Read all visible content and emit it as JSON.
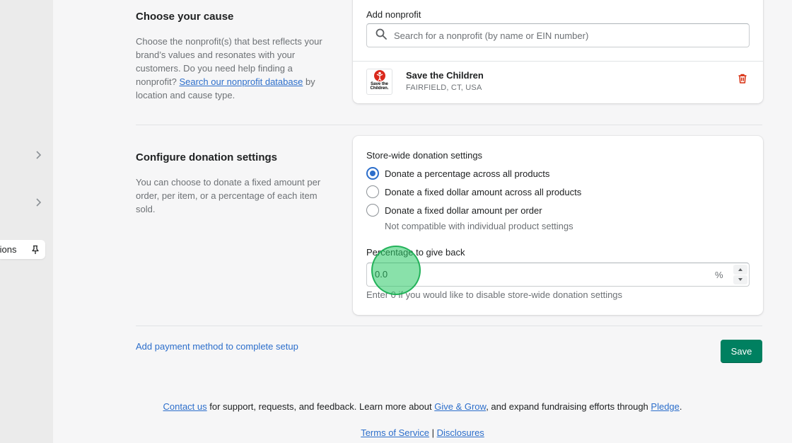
{
  "sidebar": {
    "pinned_item_label": "tions"
  },
  "cause": {
    "title": "Choose your cause",
    "desc_1": "Choose the nonprofit(s) that best reflects your brand’s values and resonates with your customers. Do you need help finding a nonprofit? ",
    "desc_link": "Search our nonprofit database",
    "desc_2": " by location and cause type.",
    "add_label": "Add nonprofit",
    "search_placeholder": "Search for a nonprofit (by name or EIN number)",
    "nonprofit": {
      "logo_text_1": "Save the",
      "logo_text_2": "Children.",
      "name": "Save the Children",
      "location": "FAIRFIELD, CT, USA"
    }
  },
  "donation": {
    "title": "Configure donation settings",
    "desc": "You can choose to donate a fixed amount per order, per item, or a percentage of each item sold.",
    "store_wide_label": "Store-wide donation settings",
    "options": [
      {
        "label": "Donate a percentage across all products",
        "checked": true
      },
      {
        "label": "Donate a fixed dollar amount across all products",
        "checked": false
      },
      {
        "label": "Donate a fixed dollar amount per order",
        "checked": false
      }
    ],
    "option_3_help": "Not compatible with individual product settings",
    "percentage_label": "Percentage to give back",
    "percentage_value": "0.0",
    "percentage_suffix": "%",
    "percentage_help": "Enter 0 if you would like to disable store-wide donation settings"
  },
  "actions": {
    "payment_link": "Add payment method to complete setup",
    "save_label": "Save"
  },
  "footer": {
    "contact_link": "Contact us",
    "text_1": " for support, requests, and feedback. Learn more about ",
    "give_grow_link": "Give & Grow",
    "text_2": ", and expand fundraising efforts through ",
    "pledge_link": "Pledge",
    "text_3": ".",
    "terms_link": "Terms of Service",
    "separator": " | ",
    "disclosures_link": "Disclosures"
  },
  "colors": {
    "primary": "#008060",
    "link": "#2c6ecb",
    "critical": "#d72c0d"
  }
}
